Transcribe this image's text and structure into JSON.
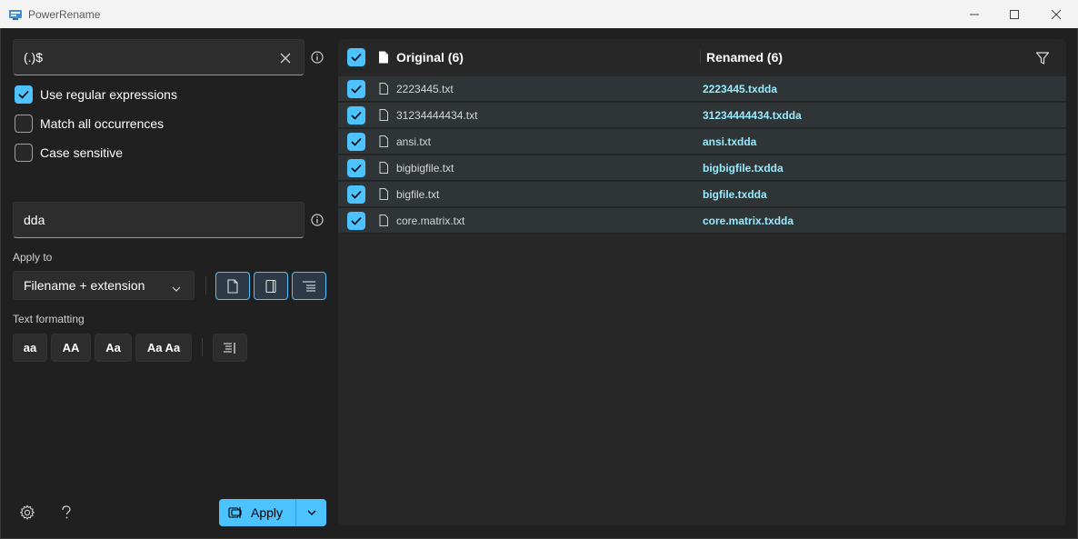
{
  "window": {
    "title": "PowerRename"
  },
  "search": {
    "value": "(.)$"
  },
  "options": {
    "use_regex": {
      "label": "Use regular expressions",
      "checked": true
    },
    "match_all": {
      "label": "Match all occurrences",
      "checked": false
    },
    "case_sensitive": {
      "label": "Case sensitive",
      "checked": false
    }
  },
  "replace": {
    "value": "dda"
  },
  "apply_to": {
    "label": "Apply to",
    "selected": "Filename + extension"
  },
  "text_formatting": {
    "label": "Text formatting",
    "buttons": [
      "aa",
      "AA",
      "Aa",
      "Aa Aa"
    ]
  },
  "apply_button": {
    "label": "Apply"
  },
  "list": {
    "original_header": "Original (6)",
    "renamed_header": "Renamed (6)",
    "rows": [
      {
        "original": "2223445.txt",
        "renamed": "2223445.txdda",
        "checked": true
      },
      {
        "original": "31234444434.txt",
        "renamed": "31234444434.txdda",
        "checked": true
      },
      {
        "original": "ansi.txt",
        "renamed": "ansi.txdda",
        "checked": true
      },
      {
        "original": "bigbigfile.txt",
        "renamed": "bigbigfile.txdda",
        "checked": true
      },
      {
        "original": "bigfile.txt",
        "renamed": "bigfile.txdda",
        "checked": true
      },
      {
        "original": "core.matrix.txt",
        "renamed": "core.matrix.txdda",
        "checked": true
      }
    ]
  },
  "colors": {
    "accent": "#4cc2ff",
    "renamed_text": "#99ebff",
    "background": "#202020"
  }
}
